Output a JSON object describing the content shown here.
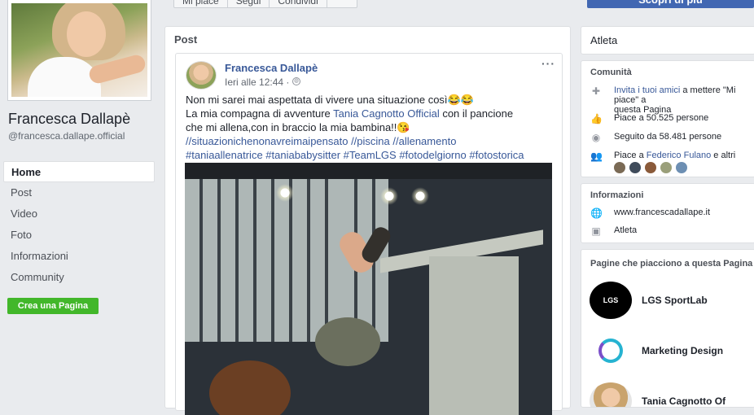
{
  "top_actions": {
    "buttons": [
      "Mi piace",
      "Segui",
      "Condividi",
      ""
    ],
    "discover": "Scopri di più"
  },
  "profile": {
    "name": "Francesca Dallapè",
    "handle": "@francesca.dallape.official"
  },
  "nav": {
    "items": [
      "Home",
      "Post",
      "Video",
      "Foto",
      "Informazioni",
      "Community"
    ],
    "create_page": "Crea una Pagina"
  },
  "feed": {
    "section_title": "Post",
    "post": {
      "author": "Francesca Dallapè",
      "time": "Ieri alle 12:44 · ",
      "more": "···",
      "text_line1": "Non mi sarei mai aspettata di vivere una situazione così😂😂",
      "text_line2_a": "La mia compagna di avventure ",
      "text_line2_link": "Tania Cagnotto Official",
      "text_line2_b": " con il pancione",
      "text_line3": "che mi allena,con in braccio la mia bambina!!😘",
      "hashtags_1": "//situazionichenonavreimaipensato //piscina //allenamento",
      "hashtags_2": "#taniaallenatrice #taniababysitter #TeamLGS #fotodelgiorno #fotostorica"
    }
  },
  "sidebar": {
    "category": "Atleta",
    "community": {
      "title": "Comunità",
      "invite_a": "Invita i tuoi amici",
      "invite_b": " a mettere \"Mi piace\" a",
      "invite_c": "questa Pagina",
      "likes": "Piace a 50.525 persone",
      "followers": "Seguito da 58.481 persone",
      "friends_a": "Piace a ",
      "friends_link": "Federico Fulano",
      "friends_b": " e altri"
    },
    "info": {
      "title": "Informazioni",
      "website": "www.francescadallape.it",
      "category": "Atleta"
    },
    "liked_pages": {
      "title": "Pagine che piacciono a questa Pagina",
      "pages": [
        "LGS SportLab",
        "Marketing Design",
        "Tania Cagnotto Of"
      ]
    }
  },
  "colors": {
    "accent": "#4267b2",
    "link": "#385898",
    "green": "#42b72a",
    "bg": "#e9ebee"
  }
}
